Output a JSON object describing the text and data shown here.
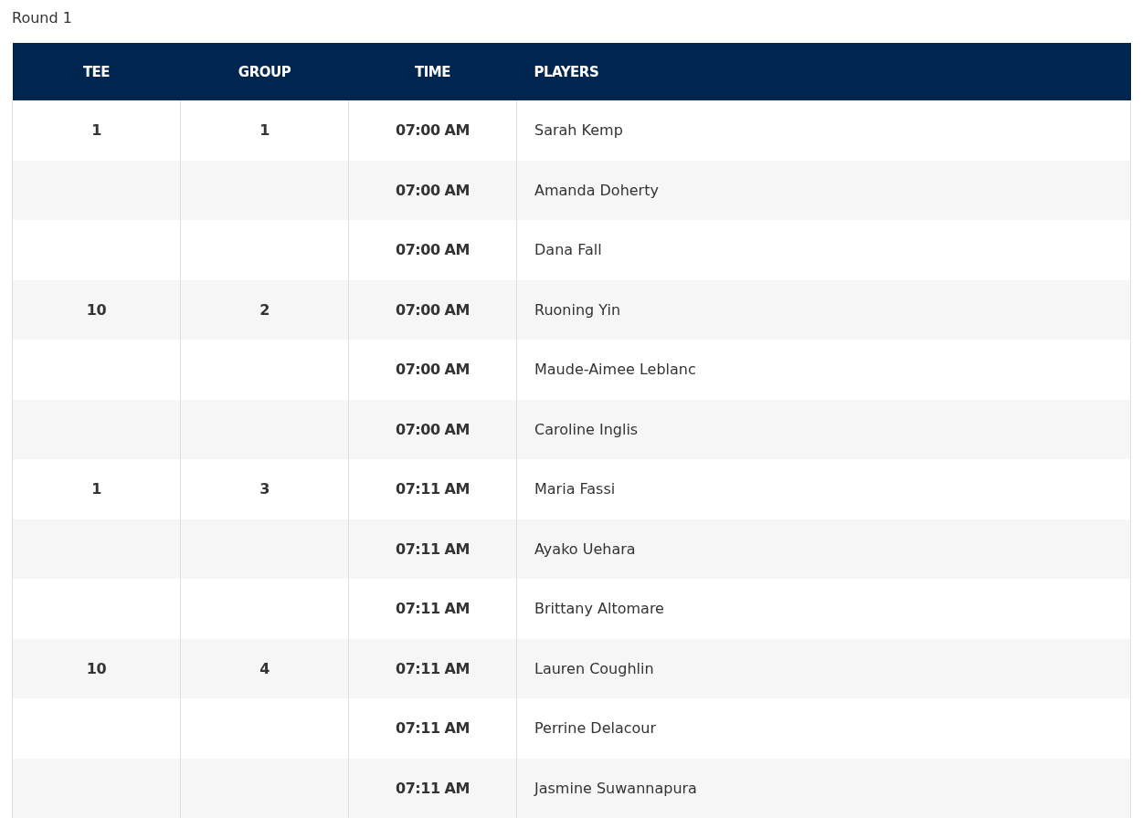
{
  "title": "Round 1",
  "table": {
    "columns": [
      "TEE",
      "GROUP",
      "TIME",
      "PLAYERS"
    ],
    "rows": [
      {
        "tee": "1",
        "group": "1",
        "time": "07:00 AM",
        "player": "Sarah Kemp"
      },
      {
        "time": "07:00 AM",
        "player": "Amanda Doherty"
      },
      {
        "time": "07:00 AM",
        "player": "Dana Fall"
      },
      {
        "tee": "10",
        "group": "2",
        "time": "07:00 AM",
        "player": "Ruoning Yin"
      },
      {
        "time": "07:00 AM",
        "player": "Maude-Aimee Leblanc"
      },
      {
        "time": "07:00 AM",
        "player": "Caroline Inglis"
      },
      {
        "tee": "1",
        "group": "3",
        "time": "07:11 AM",
        "player": "Maria Fassi"
      },
      {
        "time": "07:11 AM",
        "player": "Ayako Uehara"
      },
      {
        "time": "07:11 AM",
        "player": "Brittany Altomare"
      },
      {
        "tee": "10",
        "group": "4",
        "time": "07:11 AM",
        "player": "Lauren Coughlin"
      },
      {
        "time": "07:11 AM",
        "player": "Perrine Delacour"
      },
      {
        "time": "07:11 AM",
        "player": "Jasmine Suwannapura"
      }
    ]
  }
}
